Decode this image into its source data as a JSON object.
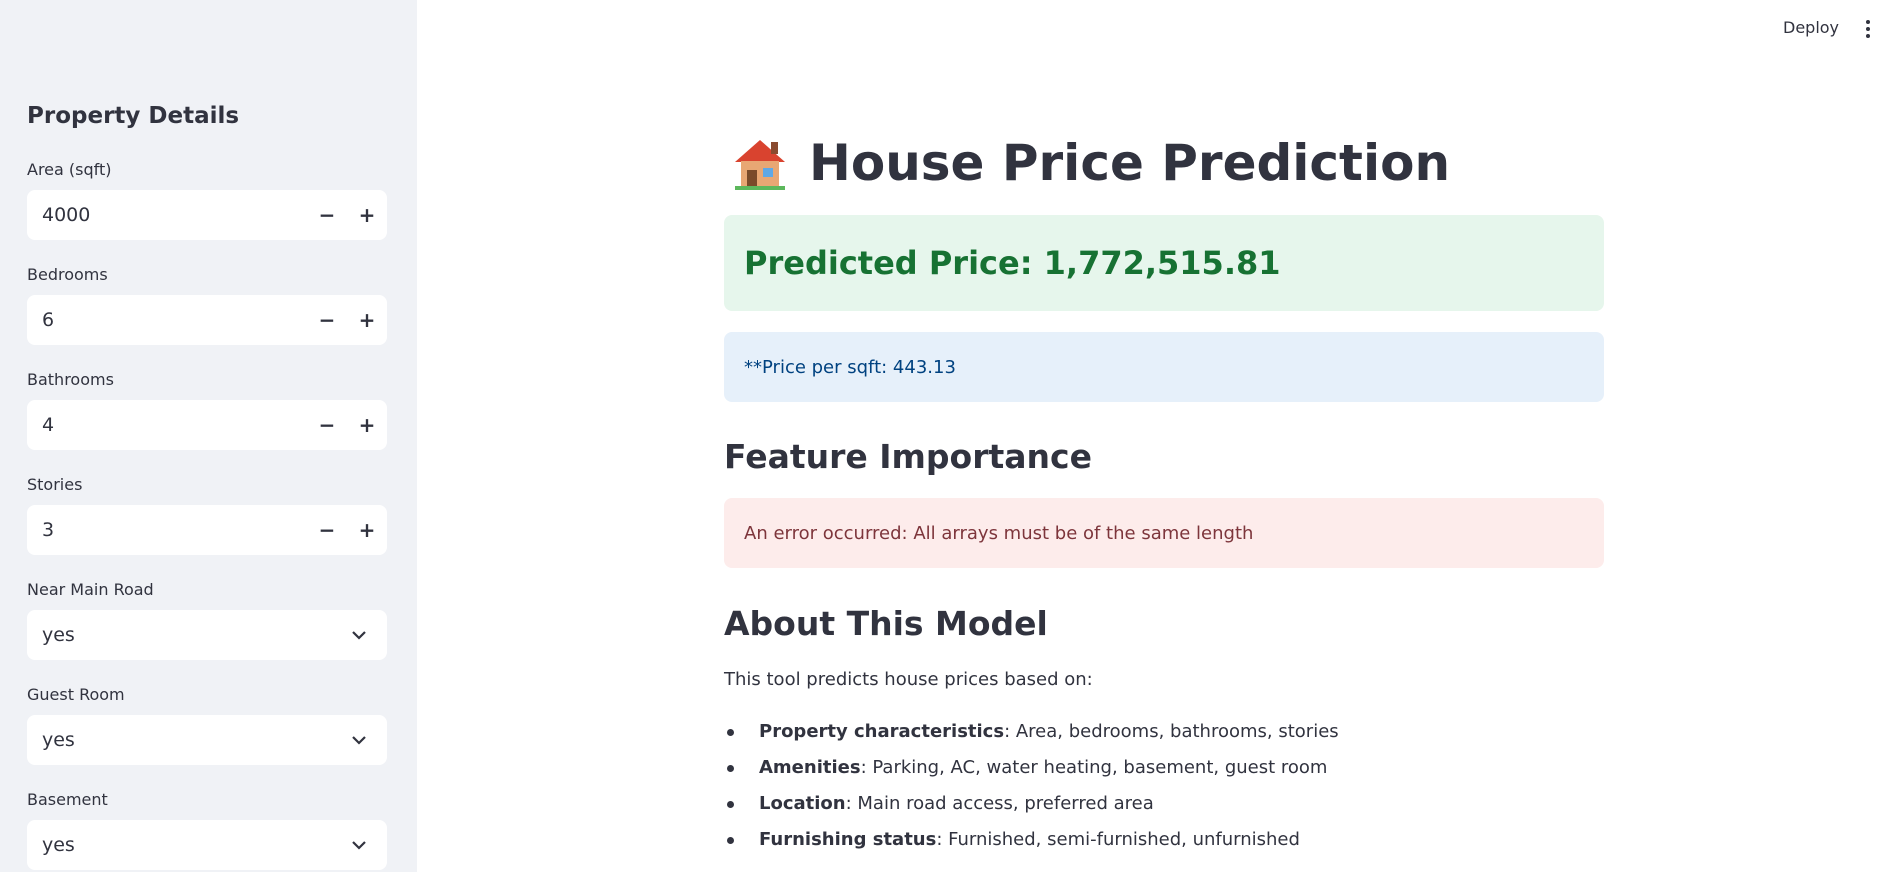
{
  "header": {
    "deploy_label": "Deploy"
  },
  "sidebar": {
    "title": "Property Details",
    "fields": [
      {
        "label": "Area (sqft)",
        "value": "4000",
        "type": "number"
      },
      {
        "label": "Bedrooms",
        "value": "6",
        "type": "number"
      },
      {
        "label": "Bathrooms",
        "value": "4",
        "type": "number"
      },
      {
        "label": "Stories",
        "value": "3",
        "type": "number"
      },
      {
        "label": "Near Main Road",
        "value": "yes",
        "type": "select"
      },
      {
        "label": "Guest Room",
        "value": "yes",
        "type": "select"
      },
      {
        "label": "Basement",
        "value": "yes",
        "type": "select"
      }
    ],
    "minus_symbol": "−",
    "plus_symbol": "+"
  },
  "main": {
    "title": "House Price Prediction",
    "title_icon": "house-icon",
    "prediction": "Predicted Price: 1,772,515.81",
    "price_per_sqft": "**Price per sqft: 443.13",
    "feature_importance_heading": "Feature Importance",
    "error_message": "An error occurred: All arrays must be of the same length",
    "about_heading": "About This Model",
    "about_intro": "This tool predicts house prices based on:",
    "bullets": [
      {
        "label": "Property characteristics",
        "text": ": Area, bedrooms, bathrooms, stories"
      },
      {
        "label": "Amenities",
        "text": ": Parking, AC, water heating, basement, guest room"
      },
      {
        "label": "Location",
        "text": ": Main road access, preferred area"
      },
      {
        "label": "Furnishing status",
        "text": ": Furnished, semi-furnished, unfurnished"
      }
    ]
  },
  "colors": {
    "sidebar_bg": "#f0f2f6",
    "success_bg": "#e6f6ec",
    "success_text": "#177233",
    "info_bg": "#e6f0fa",
    "info_text": "#004280",
    "error_bg": "#fdeceb",
    "error_text": "#7d353b"
  }
}
